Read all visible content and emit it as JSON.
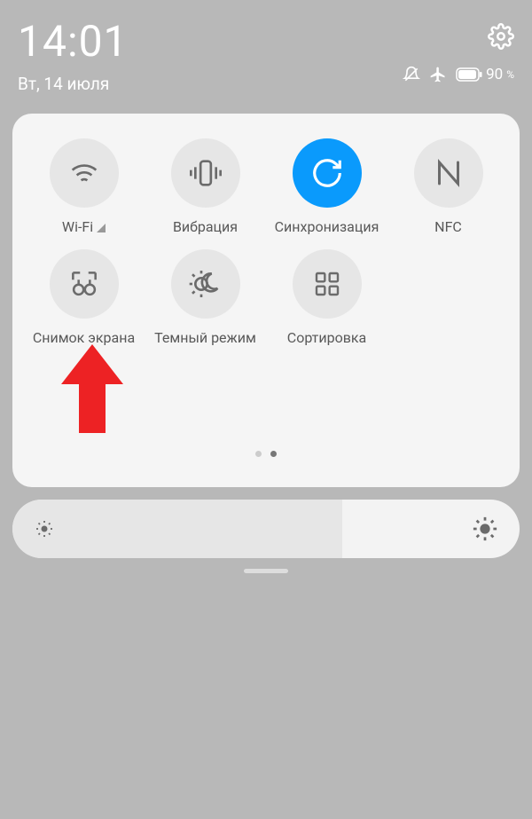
{
  "status": {
    "time": "14:01",
    "date": "Вт, 14 июля",
    "battery_percent": "90",
    "battery_suffix": "%"
  },
  "tiles": [
    {
      "label": "Wi-Fi",
      "icon": "wifi",
      "active": false
    },
    {
      "label": "Вибрация",
      "icon": "vibration",
      "active": false
    },
    {
      "label": "Синхронизация",
      "icon": "sync",
      "active": true
    },
    {
      "label": "NFC",
      "icon": "nfc",
      "active": false
    },
    {
      "label": "Снимок экрана",
      "icon": "screenshot",
      "active": false
    },
    {
      "label": "Темный режим",
      "icon": "darkmode",
      "active": false
    },
    {
      "label": "Сортировка",
      "icon": "sort",
      "active": false
    }
  ]
}
